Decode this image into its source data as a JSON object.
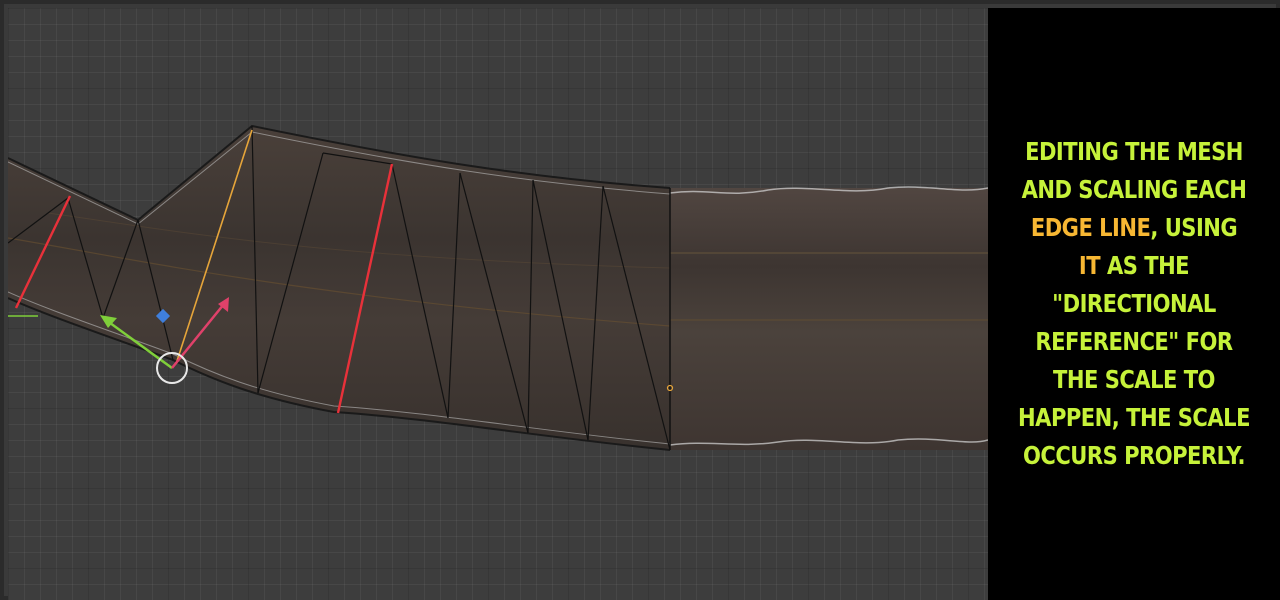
{
  "caption": {
    "segments": [
      {
        "text": "Editing the mesh and scaling each ",
        "highlight": false
      },
      {
        "text": "edge line",
        "highlight": true
      },
      {
        "text": ", using ",
        "highlight": false
      },
      {
        "text": "it",
        "highlight": true
      },
      {
        "text": " as the \"directional reference\" for the scale to happen, the scale occurs properly.",
        "highlight": false
      }
    ]
  },
  "colors": {
    "caption_text": "#c6f23a",
    "caption_highlight": "#f7b733",
    "panel_background": "#000000",
    "viewport_background": "#3d3d3d",
    "road_surface": "#3f3733",
    "selected_edge": "#e8313a",
    "active_edge": "#e6a53a",
    "gizmo_x_arrow": "#e0416a",
    "gizmo_y_arrow": "#7fcf3a",
    "gizmo_z_handle": "#3f7fdc",
    "pivot_circle": "#e8e8e8"
  },
  "icons": [
    "transform-gizmo",
    "pivot-circle-icon",
    "vertex-dot-icon"
  ]
}
